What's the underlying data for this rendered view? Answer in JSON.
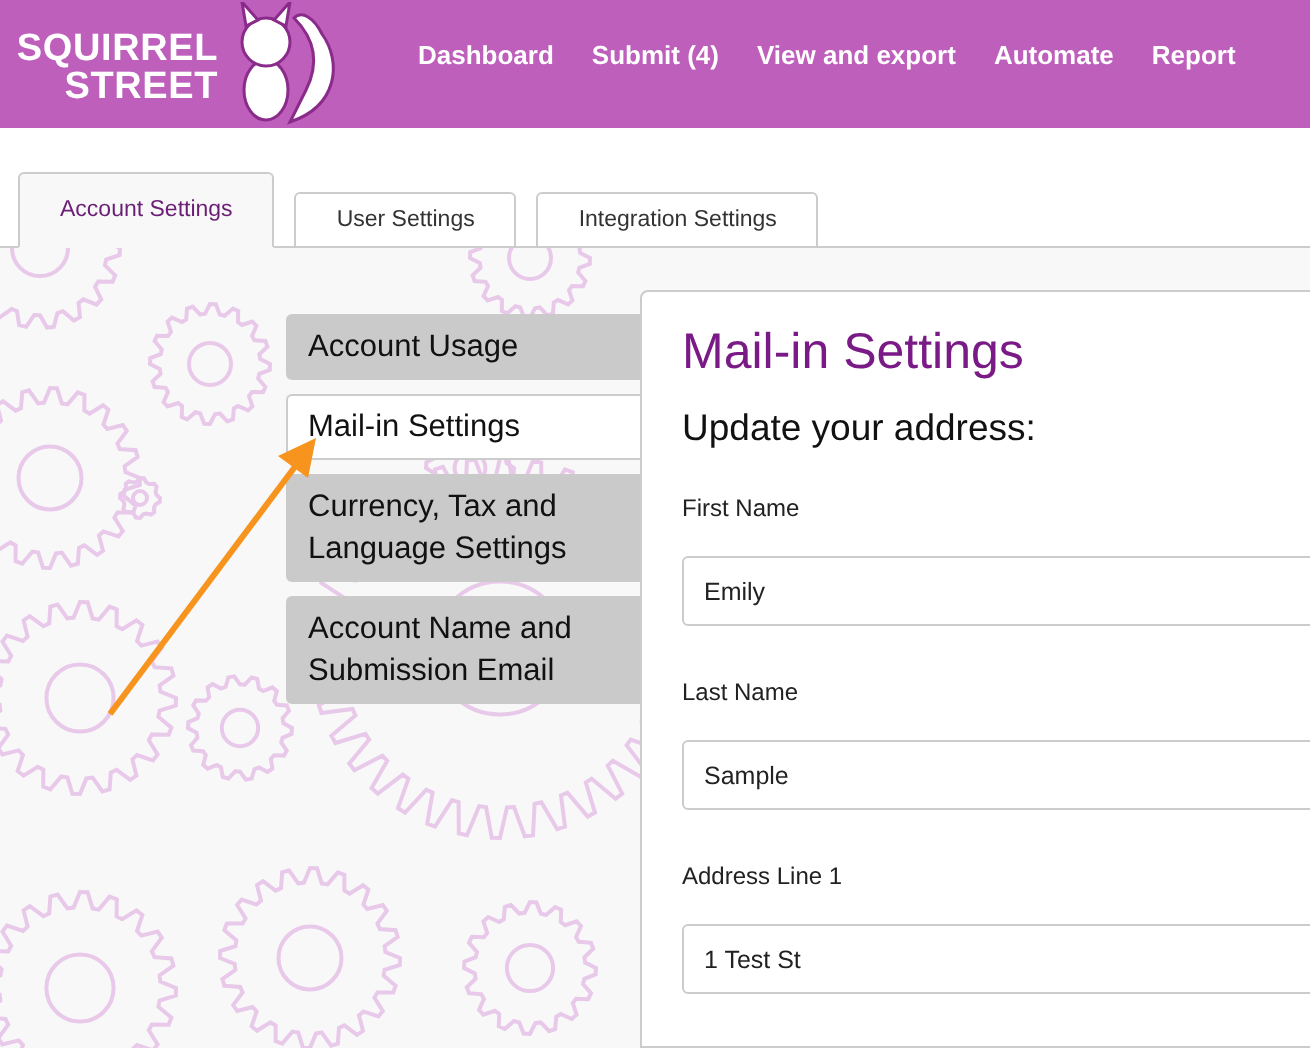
{
  "logo": {
    "line_1": "SQUIRREL",
    "line_2": "STREET"
  },
  "nav": [
    "Dashboard",
    "Submit (4)",
    "View and export",
    "Automate",
    "Report"
  ],
  "tabs": [
    {
      "label": "Account Settings",
      "selected": true
    },
    {
      "label": "User Settings",
      "selected": false
    },
    {
      "label": "Integration Settings",
      "selected": false
    }
  ],
  "side_menu": [
    {
      "label": "Account Usage",
      "selected": false
    },
    {
      "label": "Mail-in Settings",
      "selected": true
    },
    {
      "label": "Currency, Tax and Language Settings",
      "selected": false
    },
    {
      "label": "Account Name and Submission Email",
      "selected": false
    }
  ],
  "panel": {
    "title": "Mail-in Settings",
    "subtitle": "Update your address:",
    "fields": [
      {
        "label": "First Name",
        "value": "Emily"
      },
      {
        "label": "Last Name",
        "value": "Sample"
      },
      {
        "label": "Address Line 1",
        "value": "1 Test St"
      }
    ]
  }
}
